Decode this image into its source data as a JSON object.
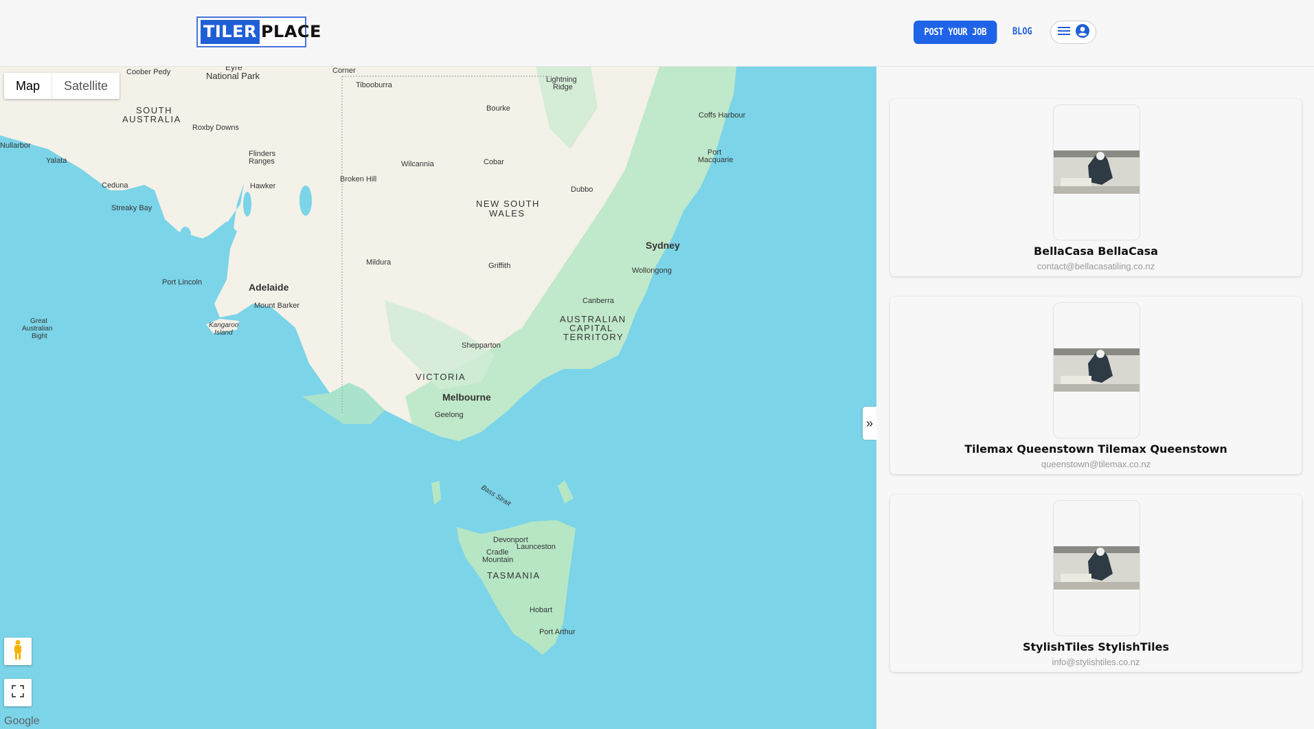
{
  "header": {
    "logo_part1": "TILER",
    "logo_part2": "PLACE",
    "post_job_label": "POST YOUR JOB",
    "blog_label": "BLOG",
    "menu_icon": "hamburger-icon",
    "profile_icon": "account-circle-icon"
  },
  "map": {
    "toggle_map": "Map",
    "toggle_satellite": "Satellite",
    "google_logo": "Google",
    "labels": {
      "sa1": "SOUTH",
      "sa2": "AUSTRALIA",
      "nsw1": "NEW SOUTH",
      "nsw2": "WALES",
      "act1": "AUSTRALIAN",
      "act2": "CAPITAL",
      "act3": "TERRITORY",
      "vic": "VICTORIA",
      "tas": "TASMANIA",
      "coober": "Coober Pedy",
      "eyre": "Eyre",
      "natpark": "National Park",
      "corner": "Corner",
      "tibooburra": "Tibooburra",
      "lightning1": "Lightning",
      "lightning2": "Ridge",
      "bourke": "Bourke",
      "coffs": "Coffs Harbour",
      "portmac1": "Port",
      "portmac2": "Macquarie",
      "roxby": "Roxby Downs",
      "nullarbor": "Nullarbor",
      "yalata": "Yalata",
      "flinders1": "Flinders",
      "flinders2": "Ranges",
      "hawker": "Hawker",
      "wilcannia": "Wilcannia",
      "cobar": "Cobar",
      "brokenhill": "Broken Hill",
      "dubbo": "Dubbo",
      "ceduna": "Ceduna",
      "streaky": "Streaky Bay",
      "sydney": "Sydney",
      "wollongong": "Wollongong",
      "mildura": "Mildura",
      "griffith": "Griffith",
      "portlincoln": "Port Lincoln",
      "adelaide": "Adelaide",
      "mtbarker": "Mount Barker",
      "canberra": "Canberra",
      "gab1": "Great",
      "gab2": "Australian",
      "gab3": "Bight",
      "kangaroo1": "Kangaroo",
      "kangaroo2": "Island",
      "shepparton": "Shepparton",
      "melbourne": "Melbourne",
      "geelong": "Geelong",
      "bass": "Bass Strait",
      "devonport": "Devonport",
      "cradle1": "Cradle",
      "cradle2": "Mountain",
      "launceston": "Launceston",
      "hobart": "Hobart",
      "portarthur": "Port Arthur"
    }
  },
  "sidebar": {
    "collapse_label": "»",
    "cards": [
      {
        "name": "BellaCasa BellaCasa",
        "email": "contact@bellacasatiling.co.nz"
      },
      {
        "name": "Tilemax Queenstown Tilemax Queenstown",
        "email": "queenstown@tilemax.co.nz"
      },
      {
        "name": "StylishTiles StylishTiles",
        "email": "info@stylishtiles.co.nz"
      }
    ]
  },
  "colors": {
    "brand_blue": "#1f63e8",
    "water": "#7bd4e8",
    "land": "#f4f1e8",
    "forest": "#b6e6c4"
  }
}
